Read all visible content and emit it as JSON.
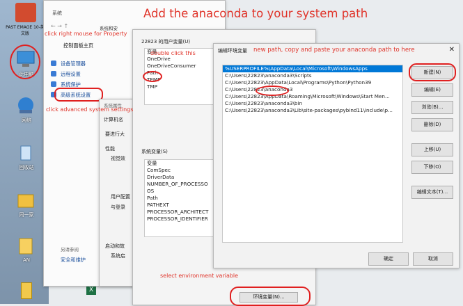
{
  "banner": {
    "title": "Add the anaconda to your system path",
    "right_click_hint": "click right mouse for Property",
    "double_click_hint": "double click this",
    "advanced_hint": "click advanced system settings",
    "env_var_hint": "select environment variable",
    "new_path_hint": "new path, copy and paste your anaconda path to here"
  },
  "desktop": {
    "icons": [
      {
        "label": "PAST EMAGE 10-英文版"
      },
      {
        "label": "此电脑"
      },
      {
        "label": "网络"
      },
      {
        "label": "回收站"
      },
      {
        "label": "同一家"
      },
      {
        "label": "AN"
      }
    ]
  },
  "system_window": {
    "title": "系统",
    "breadcrumb": "系统和安",
    "control_home": "控制面板主页",
    "nav": [
      "设备管理器",
      "远程设置",
      "系统保护",
      "高级系统设置"
    ],
    "see_also": "另请参阅",
    "security": "安全和维护"
  },
  "sys_props": {
    "title": "系统属性",
    "tab": "计算机名",
    "admin_note": "要进行大",
    "perf": "性能",
    "visual": "视觉效",
    "user_profile": "用户配置",
    "related": "与登录",
    "startup": "启动和故",
    "sys_start": "系统启"
  },
  "env_window": {
    "user_section": "22823 的用户变量(U)",
    "user_header": "变量",
    "user_vars": [
      "OneDrive",
      "OneDriveConsumer",
      "Path",
      "TEMP",
      "TMP"
    ],
    "sys_section": "系统变量(S)",
    "sys_header": "变量",
    "sys_vars": [
      "ComSpec",
      "DriverData",
      "NUMBER_OF_PROCESSO",
      "OS",
      "Path",
      "PATHEXT",
      "PROCESSOR_ARCHITECT",
      "PROCESSOR_IDENTIFIER"
    ],
    "env_button": "环境变量(N)..."
  },
  "edit_dialog": {
    "title": "编辑环境变量",
    "close": "✕",
    "paths": [
      "%USERPROFILE%\\AppData\\Local\\Microsoft\\WindowsApps",
      "C:\\Users\\22823\\anaconda3\\Scripts",
      "C:\\Users\\22823\\AppData\\Local\\Programs\\Python\\Python39",
      "C:\\Users\\22823\\anaconda3",
      "C:\\Users\\22823\\AppData\\Roaming\\Microsoft\\Windows\\Start Men...",
      "C:\\Users\\22823\\anaconda3\\bin",
      "C:\\Users\\22823\\anaconda3\\Lib\\site-packages\\pybind11\\include\\p..."
    ],
    "buttons": [
      "新建(N)",
      "编辑(E)",
      "浏览(B)...",
      "删除(D)",
      "上移(U)",
      "下移(O)",
      "编辑文本(T)..."
    ],
    "ok": "确定",
    "cancel": "取消"
  },
  "colors": {
    "accent_red": "#e02020",
    "selection_blue": "#0078d7"
  }
}
